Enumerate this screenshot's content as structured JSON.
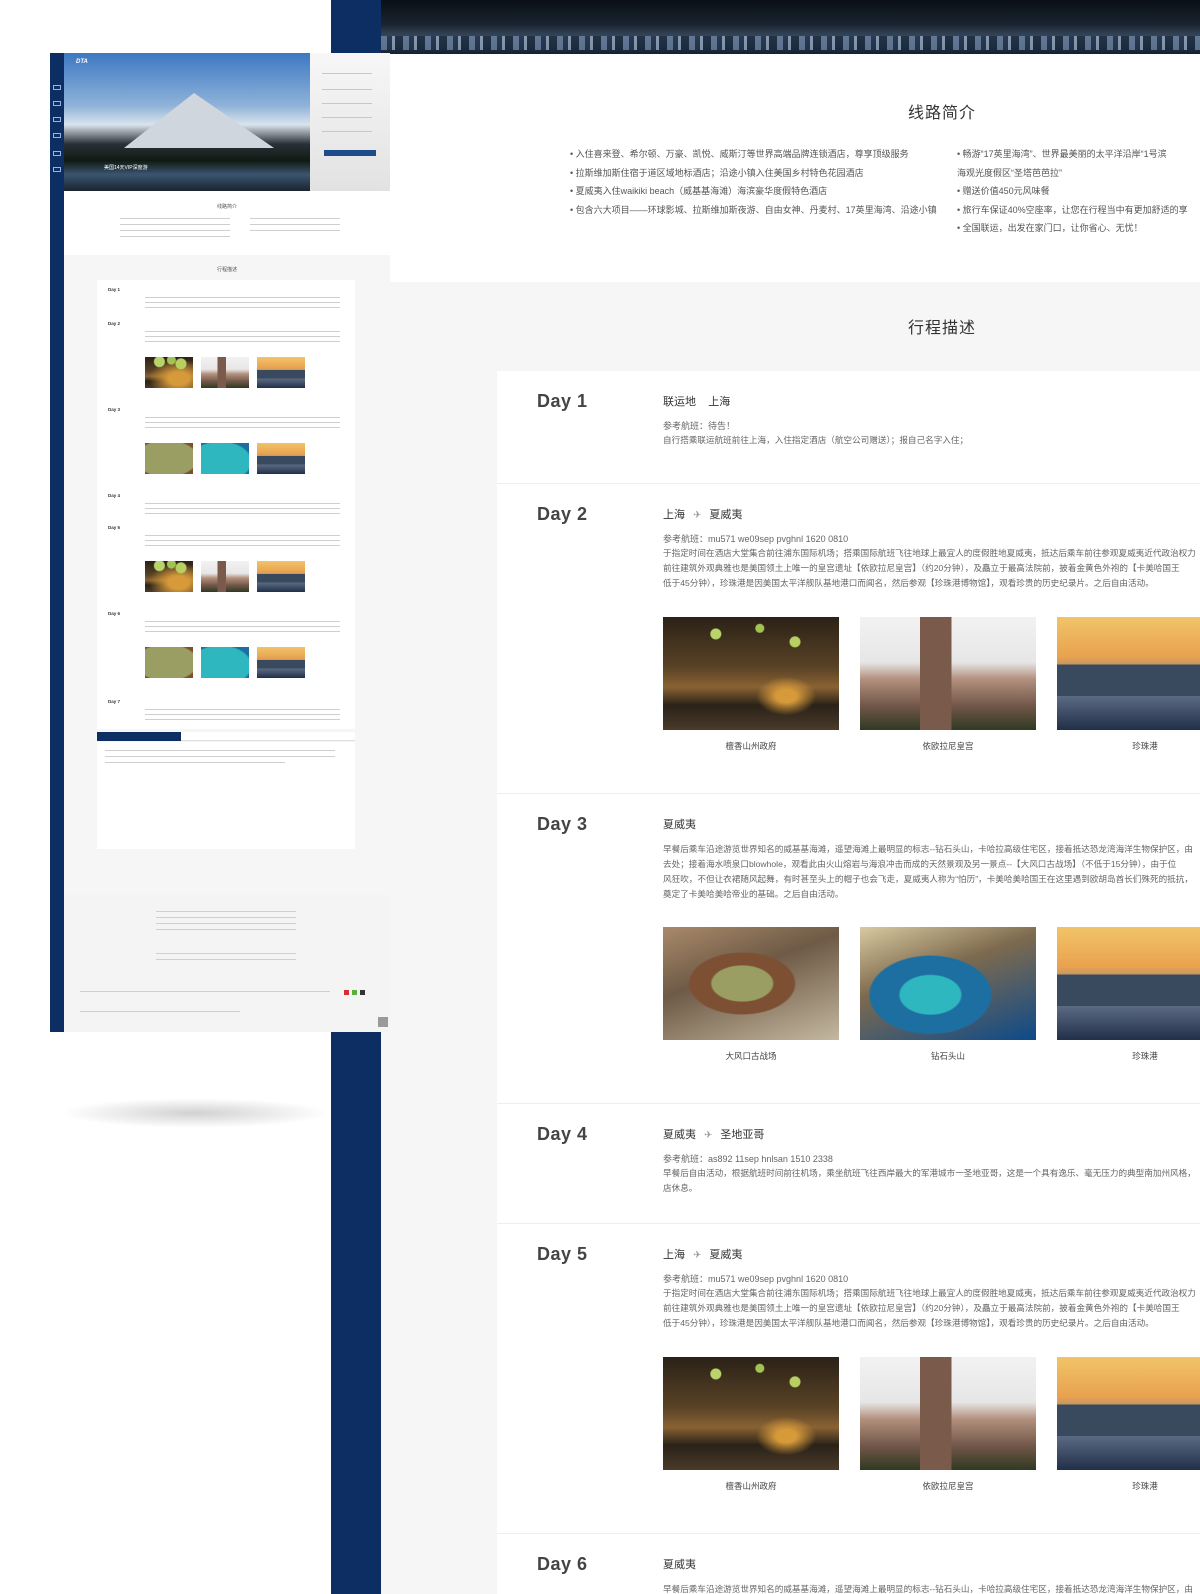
{
  "intro": {
    "title": "线路简介",
    "left": [
      "• 入住喜来登、希尔顿、万豪、凯悦、威斯汀等世界高端品牌连锁酒店，尊享顶级服务",
      "• 拉斯维加斯住宿于道区域地标酒店；沿途小镇入住美国乡村特色花园酒店",
      "• 夏威夷入住waikiki beach（威基基海滩）海滨豪华度假特色酒店",
      "• 包含六大项目——环球影城、拉斯维加斯夜游、自由女神、丹麦村、17英里海湾、沿途小镇"
    ],
    "right": [
      "• 畅游“17英里海湾”、世界最美丽的太平洋沿岸“1号滨",
      "  海观光度假区“圣塔芭芭拉”",
      "• 赠送价值450元风味餐",
      "• 旅行车保证40%空座率，让您在行程当中有更加舒适的享",
      "• 全国联运，出发在家门口，让你省心、无忧！"
    ]
  },
  "itinerary": {
    "title": "行程描述",
    "days": [
      {
        "label": "Day 1",
        "from": "联运地",
        "to": "上海",
        "has_plane": false,
        "ref": "参考航班：待告！",
        "desc": [
          "自行搭乘联运航班前往上海，入住指定酒店（航空公司赠送）；报自己名字入住；"
        ]
      },
      {
        "label": "Day 2",
        "from": "上海",
        "to": "夏威夷",
        "has_plane": true,
        "ref": "参考航班：mu571   we09sep  pvghnl   1620 0810",
        "desc": [
          "于指定时间在酒店大堂集合前往浦东国际机场；搭乘国际航班飞往地球上最宜人的度假胜地夏威夷，抵达后乘车前往参观夏威夷近代政治权力",
          "前往建筑外观典雅也是美国领土上唯一的皇宫遗址【依欧拉尼皇宫】（约20分钟），及矗立于最高法院前，披着金黄色外袍的【卡美哈国王",
          "低于45分钟），珍珠港是因美国太平洋舰队基地港口而闻名，然后参观【珍珠港博物馆】，观看珍贵的历史纪录片。之后自由活动。"
        ],
        "photos": [
          {
            "caption": "檀香山州政府",
            "kind": "capitol"
          },
          {
            "caption": "依欧拉尼皇宫",
            "kind": "palace"
          },
          {
            "caption": "珍珠港",
            "kind": "harbor"
          }
        ]
      },
      {
        "label": "Day 3",
        "from": "夏威夷",
        "to": "",
        "has_plane": false,
        "ref": "",
        "desc": [
          "早餐后乘车沿途游览世界知名的威基基海滩，遥望海滩上最明显的标志--钻石头山，卡哈拉高级住宅区，接着抵达恐龙湾海洋生物保护区，由",
          "去处；接着海水喷泉口blowhole，观看此由火山熔岩与海浪冲击而成的天然景观及另一景点--【大风口古战场】（不低于15分钟），由于位",
          "风狂吹，不但让衣裙随风起舞，有时甚至头上的帽子也会飞走，夏威夷人称为“怕历”，卡美哈美哈国王在这里遇到欧胡岛酋长们殊死的抵抗，",
          "奠定了卡美哈美哈帝业的基础。之后自由活动。"
        ],
        "photos": [
          {
            "caption": "大风口古战场",
            "kind": "crater"
          },
          {
            "caption": "钻石头山",
            "kind": "bay"
          },
          {
            "caption": "珍珠港",
            "kind": "harbor"
          }
        ]
      },
      {
        "label": "Day 4",
        "from": "夏威夷",
        "to": "圣地亚哥",
        "has_plane": true,
        "ref": "参考航班：as892   11sep   hnlsan   1510  2338",
        "desc": [
          "早餐后自由活动，根据航班时间前往机场，乘坐航班飞往西岸最大的军港城市一圣地亚哥，这是一个具有逸乐、毫无压力的典型南加州风格，",
          "店休息。"
        ]
      },
      {
        "label": "Day 5",
        "from": "上海",
        "to": "夏威夷",
        "has_plane": true,
        "ref": "参考航班：mu571   we09sep  pvghnl   1620 0810",
        "desc": [
          "于指定时间在酒店大堂集合前往浦东国际机场；搭乘国际航班飞往地球上最宜人的度假胜地夏威夷，抵达后乘车前往参观夏威夷近代政治权力",
          "前往建筑外观典雅也是美国领土上唯一的皇宫遗址【依欧拉尼皇宫】（约20分钟），及矗立于最高法院前，披着金黄色外袍的【卡美哈国王",
          "低于45分钟），珍珠港是因美国太平洋舰队基地港口而闻名，然后参观【珍珠港博物馆】，观看珍贵的历史纪录片。之后自由活动。"
        ],
        "photos": [
          {
            "caption": "檀香山州政府",
            "kind": "capitol"
          },
          {
            "caption": "依欧拉尼皇宫",
            "kind": "palace"
          },
          {
            "caption": "珍珠港",
            "kind": "harbor"
          }
        ]
      },
      {
        "label": "Day 6",
        "from": "夏威夷",
        "to": "",
        "has_plane": false,
        "ref": "",
        "desc": [
          "早餐后乘车沿途游览世界知名的威基基海滩，遥望海滩上最明显的标志--钻石头山，卡哈拉高级住宅区，接着抵达恐龙湾海洋生物保护区，由"
        ]
      }
    ]
  },
  "mini": {
    "logo": "DTA",
    "hero_badge": "美国14天VIP深度游",
    "intro_title": "线路简介",
    "itinerary_title": "行程描述",
    "days": [
      "Day 1",
      "Day 2",
      "Day 3",
      "Day 4",
      "Day 5",
      "Day 6",
      "Day 7"
    ]
  },
  "colors": {
    "sidebar": "#0c2e63",
    "section_bg": "#f6f6f6"
  }
}
